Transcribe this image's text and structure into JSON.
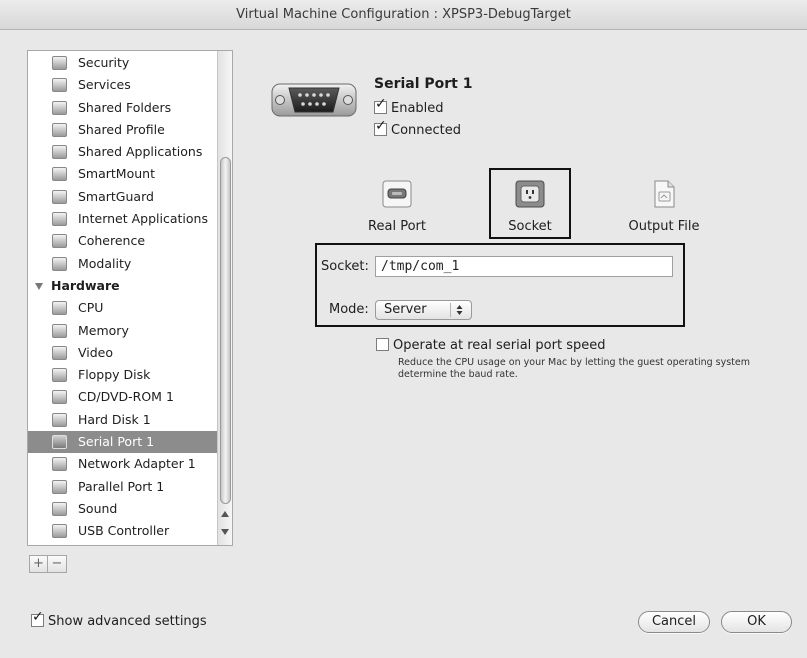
{
  "window": {
    "title": "Virtual Machine Configuration : XPSP3-DebugTarget"
  },
  "sidebar": {
    "items_top": [
      {
        "label": "Security",
        "icon": "shield-icon"
      },
      {
        "label": "Services",
        "icon": "services-icon"
      },
      {
        "label": "Shared Folders",
        "icon": "shared-folders-icon"
      },
      {
        "label": "Shared Profile",
        "icon": "shared-profile-icon"
      },
      {
        "label": "Shared Applications",
        "icon": "shared-applications-icon"
      },
      {
        "label": "SmartMount",
        "icon": "smartmount-icon"
      },
      {
        "label": "SmartGuard",
        "icon": "smartguard-icon"
      },
      {
        "label": "Internet Applications",
        "icon": "internet-applications-icon"
      },
      {
        "label": "Coherence",
        "icon": "coherence-icon"
      },
      {
        "label": "Modality",
        "icon": "modality-icon"
      }
    ],
    "hardware_header": "Hardware",
    "items_hw": [
      {
        "label": "CPU",
        "icon": "cpu-icon"
      },
      {
        "label": "Memory",
        "icon": "memory-icon"
      },
      {
        "label": "Video",
        "icon": "video-icon"
      },
      {
        "label": "Floppy Disk",
        "icon": "floppy-icon"
      },
      {
        "label": "CD/DVD-ROM 1",
        "icon": "cd-icon"
      },
      {
        "label": "Hard Disk 1",
        "icon": "hard-disk-icon"
      },
      {
        "label": "Serial Port 1",
        "icon": "serial-port-icon",
        "selected": true
      },
      {
        "label": "Network Adapter 1",
        "icon": "network-icon"
      },
      {
        "label": "Parallel Port 1",
        "icon": "parallel-port-icon"
      },
      {
        "label": "Sound",
        "icon": "sound-icon"
      },
      {
        "label": "USB Controller",
        "icon": "usb-icon"
      }
    ],
    "add_symbol": "+",
    "remove_symbol": "−"
  },
  "device": {
    "title": "Serial Port 1",
    "enabled_label": "Enabled",
    "enabled": true,
    "connected_label": "Connected",
    "connected": true
  },
  "connection_types": {
    "real_port": "Real Port",
    "socket": "Socket",
    "output_file": "Output File",
    "selected": "Socket"
  },
  "socket_settings": {
    "socket_label": "Socket:",
    "socket_value": "/tmp/com_1",
    "mode_label": "Mode:",
    "mode_value": "Server"
  },
  "speed_option": {
    "label": "Operate at real serial port speed",
    "checked": false,
    "description": "Reduce the CPU usage on your Mac by letting the guest operating system determine the baud rate."
  },
  "footer": {
    "advanced_label": "Show advanced settings",
    "advanced_checked": true,
    "cancel_label": "Cancel",
    "ok_label": "OK"
  }
}
